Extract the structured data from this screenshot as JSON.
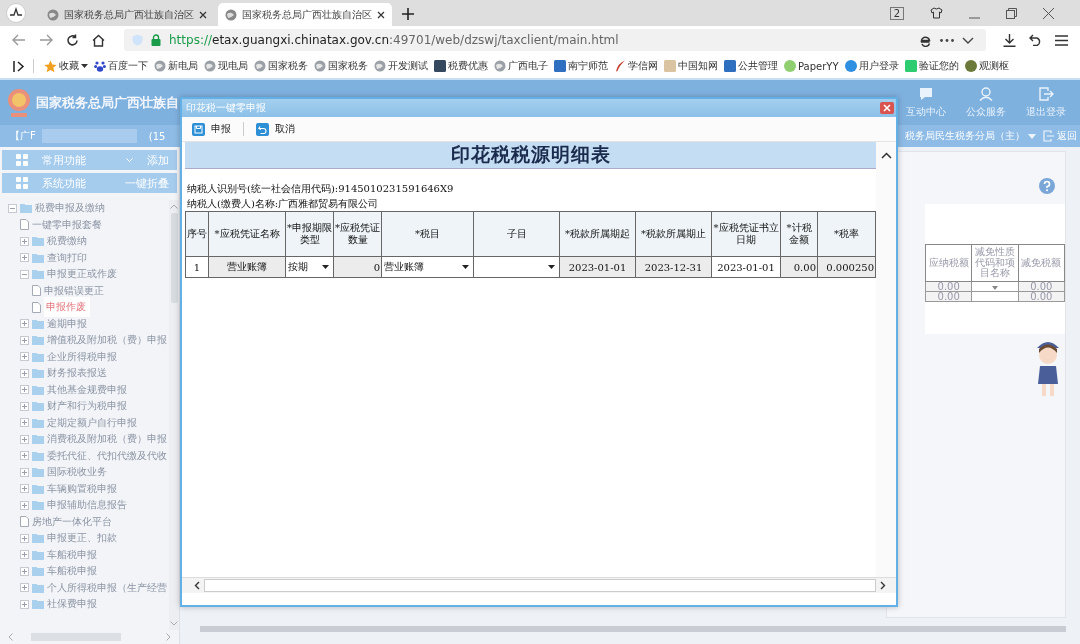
{
  "browser": {
    "tabs": [
      {
        "title": "国家税务总局广西壮族自治区",
        "selected": false
      },
      {
        "title": "国家税务总局广西壮族自治区",
        "selected": true
      }
    ],
    "tab_count": "2",
    "url": {
      "scheme": "https://",
      "host": "etax.guangxi.chinatax.gov.cn",
      "path": ":49701/web/dzswj/taxclient/main.html"
    },
    "favorites": {
      "label": "收藏"
    },
    "bookmarks": [
      {
        "label": "百度一下",
        "kind": "paw"
      },
      {
        "label": "新电局",
        "kind": "globe"
      },
      {
        "label": "现电局",
        "kind": "globe"
      },
      {
        "label": "国家税务",
        "kind": "globe"
      },
      {
        "label": "国家税务",
        "kind": "globe"
      },
      {
        "label": "开发测试",
        "kind": "globe"
      },
      {
        "label": "税费优惠",
        "kind": "darktile"
      },
      {
        "label": "广西电子",
        "kind": "globe"
      },
      {
        "label": "南宁师范",
        "kind": "tile"
      },
      {
        "label": "学信网",
        "kind": "quill"
      },
      {
        "label": "中国知网",
        "kind": "zhi"
      },
      {
        "label": "公共管理",
        "kind": "tile"
      },
      {
        "label": "PaperYY",
        "kind": "ring"
      },
      {
        "label": "用户登录",
        "kind": "swirl"
      },
      {
        "label": "验证您的",
        "kind": "u"
      },
      {
        "label": "观测枢",
        "kind": "earth"
      }
    ]
  },
  "app": {
    "title": "国家税务总局广西壮族自",
    "header_links": [
      {
        "label": "互动中心",
        "kind": "chat"
      },
      {
        "label": "公众服务",
        "kind": "user"
      },
      {
        "label": "退出登录",
        "kind": "exit"
      }
    ],
    "user_left": "【广F",
    "user_mid": "(15",
    "org": "税务局民生税务分局（主）",
    "back": "返回"
  },
  "sidebar": {
    "panels": [
      {
        "label": "常用功能",
        "action": "添加",
        "kind": "chevron"
      },
      {
        "label": "系统功能",
        "action": "一键折叠",
        "kind": "plain"
      }
    ],
    "tree": [
      {
        "label": "税费申报及缴纳",
        "kind": "folder",
        "expanded": true,
        "selected": false,
        "children": [
          {
            "label": "一键零申报套餐",
            "kind": "doc",
            "selected": false
          },
          {
            "label": "税费缴纳",
            "kind": "folder",
            "expanded": false,
            "selected": false
          },
          {
            "label": "查询打印",
            "kind": "folder",
            "expanded": false,
            "selected": false
          },
          {
            "label": "申报更正或作废",
            "kind": "folder",
            "expanded": true,
            "selected": false,
            "children": [
              {
                "label": "申报错误更正",
                "kind": "doc",
                "selected": false
              },
              {
                "label": "申报作废",
                "kind": "doc",
                "selected": true
              }
            ]
          },
          {
            "label": "逾期申报",
            "kind": "folder",
            "expanded": false,
            "selected": false
          },
          {
            "label": "增值税及附加税（费）申报",
            "kind": "folder",
            "expanded": false,
            "selected": false
          },
          {
            "label": "企业所得税申报",
            "kind": "folder",
            "expanded": false,
            "selected": false
          },
          {
            "label": "财务报表报送",
            "kind": "folder",
            "expanded": false,
            "selected": false
          },
          {
            "label": "其他基金规费申报",
            "kind": "folder",
            "expanded": false,
            "selected": false
          },
          {
            "label": "财产和行为税申报",
            "kind": "folder",
            "expanded": false,
            "selected": false
          },
          {
            "label": "定期定额户自行申报",
            "kind": "folder",
            "expanded": false,
            "selected": false
          },
          {
            "label": "消费税及附加税（费）申报",
            "kind": "folder",
            "expanded": false,
            "selected": false
          },
          {
            "label": "委托代征、代扣代缴及代收",
            "kind": "folder",
            "expanded": false,
            "selected": false
          },
          {
            "label": "国际税收业务",
            "kind": "folder",
            "expanded": false,
            "selected": false
          },
          {
            "label": "车辆购置税申报",
            "kind": "folder",
            "expanded": false,
            "selected": false
          },
          {
            "label": "申报辅助信息报告",
            "kind": "folder",
            "expanded": false,
            "selected": false
          },
          {
            "label": "房地产一体化平台",
            "kind": "doc",
            "selected": false
          },
          {
            "label": "申报更正、扣款",
            "kind": "folder",
            "expanded": false,
            "selected": false
          },
          {
            "label": "车船税申报",
            "kind": "folder",
            "expanded": false,
            "selected": false
          },
          {
            "label": "车船税申报",
            "kind": "folder",
            "expanded": false,
            "selected": false
          },
          {
            "label": "个人所得税申报（生产经营",
            "kind": "folder",
            "expanded": false,
            "selected": false
          },
          {
            "label": "社保费申报",
            "kind": "folder",
            "expanded": false,
            "selected": false
          }
        ]
      }
    ]
  },
  "background_table": {
    "columns": [
      "应纳税额",
      "减免性质代码和项目名称",
      "减免税额"
    ],
    "rows": [
      [
        {
          "text": "0.00",
          "kind": "number"
        },
        {
          "text": "",
          "kind": "select"
        },
        {
          "text": "0.00",
          "kind": "number"
        }
      ],
      [
        {
          "text": "0.00",
          "kind": "number"
        },
        {
          "text": "",
          "kind": "text"
        },
        {
          "text": "0.00",
          "kind": "number"
        }
      ]
    ]
  },
  "dialog": {
    "title": "印花税一键零申报",
    "toolbar": [
      {
        "label": "申报",
        "kind": "save"
      },
      {
        "label": "取消",
        "kind": "undo"
      }
    ],
    "heading": "印花税税源明细表",
    "info": [
      "纳税人识别号(统一社会信用代码):9145010231591646X9",
      "纳税人(缴费人)名称:广西雅都贸易有限公司"
    ],
    "columns": [
      "序号",
      "*应税凭证名称",
      "*申报期限类型",
      "*应税凭证数量",
      "*税目",
      "子目",
      "*税款所属期起",
      "*税款所属期止",
      "*应税凭证书立日期",
      "*计税金额",
      "*税率"
    ],
    "rows": [
      [
        {
          "text": "1",
          "kind": "text"
        },
        {
          "text": "营业账簿",
          "kind": "readonly"
        },
        {
          "text": "按期",
          "kind": "select"
        },
        {
          "text": "0",
          "kind": "number"
        },
        {
          "text": "营业账簿",
          "kind": "select"
        },
        {
          "text": "",
          "kind": "select"
        },
        {
          "text": "2023-01-01",
          "kind": "readonly"
        },
        {
          "text": "2023-12-31",
          "kind": "readonly"
        },
        {
          "text": "2023-01-01",
          "kind": "input"
        },
        {
          "text": "0.00",
          "kind": "number"
        },
        {
          "text": "0.000250",
          "kind": "number"
        }
      ]
    ]
  }
}
